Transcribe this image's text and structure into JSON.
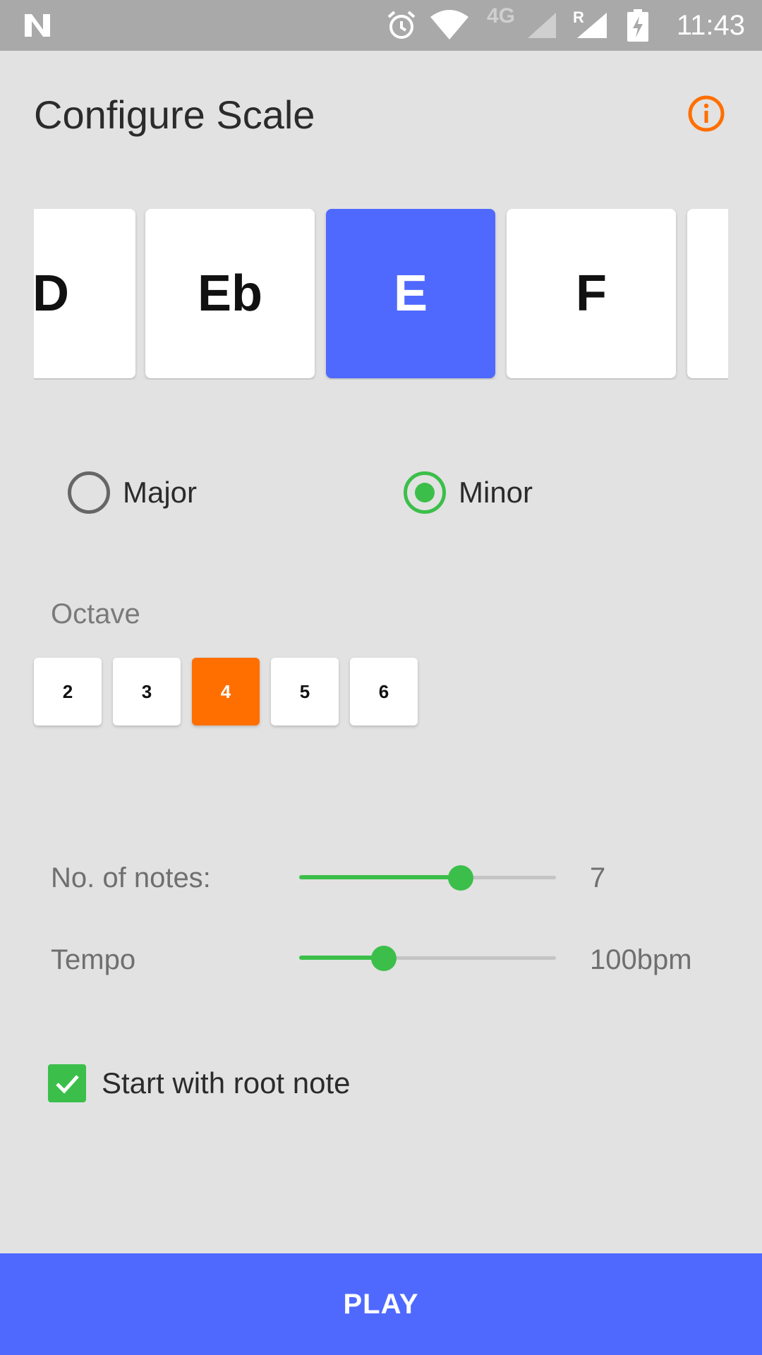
{
  "status_bar": {
    "time": "11:43",
    "network_label": "4G",
    "roaming_label": "R",
    "icons": [
      "n-logo-icon",
      "alarm-icon",
      "wifi-icon",
      "cell-signal-icon",
      "roaming-signal-icon",
      "battery-charging-icon"
    ]
  },
  "header": {
    "title": "Configure Scale",
    "info_icon": "info-icon"
  },
  "keys": {
    "items": [
      "D",
      "Eb",
      "E",
      "F",
      ""
    ],
    "selected": "E"
  },
  "scale_type": {
    "options": [
      {
        "label": "Major",
        "checked": false
      },
      {
        "label": "Minor",
        "checked": true
      }
    ]
  },
  "octave": {
    "label": "Octave",
    "options": [
      "2",
      "3",
      "4",
      "5",
      "6"
    ],
    "selected": "4"
  },
  "notes": {
    "label": "No. of notes:",
    "value": "7",
    "fraction": 0.63
  },
  "tempo": {
    "label": "Tempo",
    "value": "100bpm",
    "fraction": 0.33
  },
  "root_note": {
    "label": "Start with root note",
    "checked": true
  },
  "play": {
    "label": "PLAY"
  },
  "colors": {
    "primary": "#4f69ff",
    "accent_orange": "#ff6f00",
    "accent_green": "#3bbf4a",
    "background": "#e2e2e2"
  }
}
